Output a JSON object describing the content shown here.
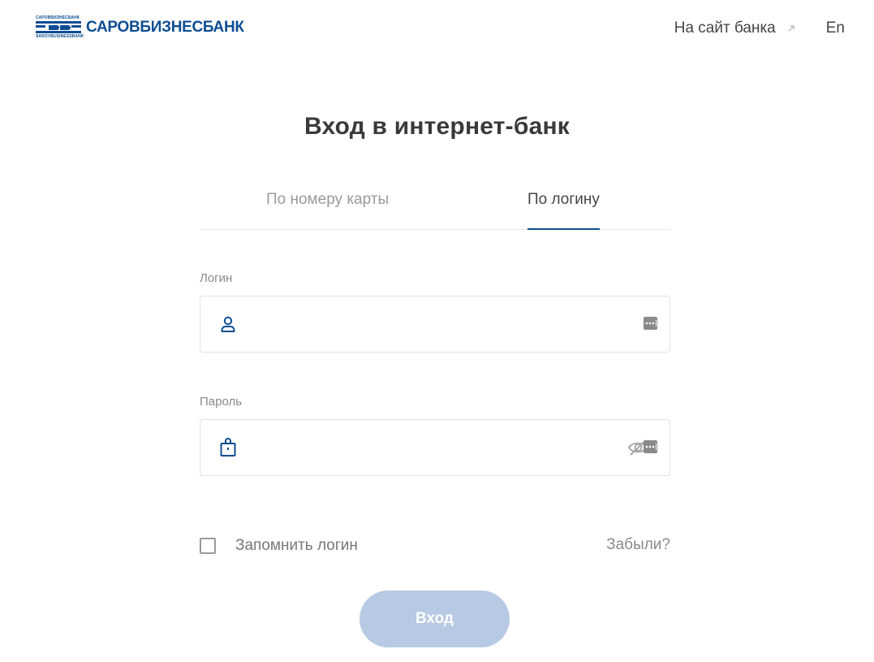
{
  "header": {
    "logo": {
      "small_line_top": "САРОВБИЗНЕСБАНК",
      "small_line_bottom": "SAROVBUSINESSBANK",
      "text": "САРОВБИЗНЕСБАНК",
      "color": "#0e4d92"
    },
    "bank_site_link": "На сайт банка",
    "language": "En"
  },
  "title": "Вход в интернет-банк",
  "tabs": [
    {
      "label": "По номеру карты",
      "active": false
    },
    {
      "label": "По логину",
      "active": true
    }
  ],
  "form": {
    "login": {
      "label": "Логин",
      "value": "",
      "placeholder": ""
    },
    "password": {
      "label": "Пароль",
      "value": "",
      "placeholder": ""
    },
    "remember_label": "Запомнить логин",
    "remember_checked": false,
    "forgot_label": "Забыли?",
    "submit_label": "Вход"
  },
  "colors": {
    "accent": "#0e4d92",
    "button_disabled": "#b7c9e3"
  },
  "icons": {
    "login_field": "user-icon",
    "password_field": "lock-icon",
    "password_visibility": "eye-crossed-icon",
    "password_manager": "password-manager-icon",
    "external_link": "external-arrow-icon"
  }
}
